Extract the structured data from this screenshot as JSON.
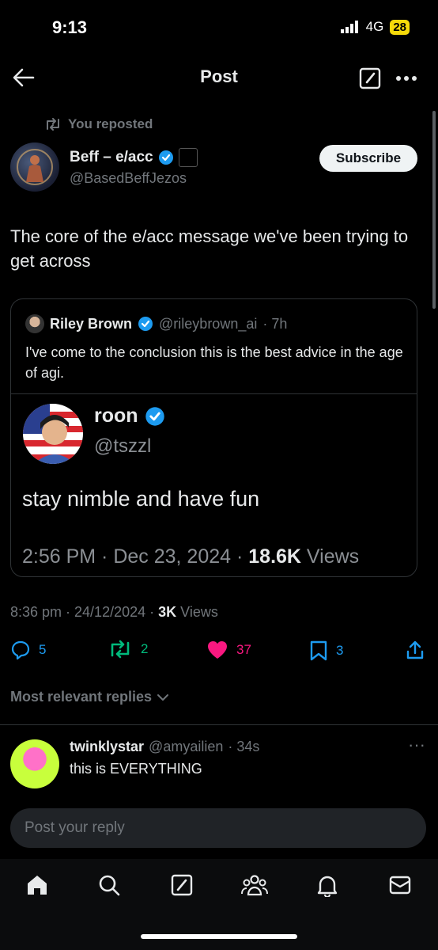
{
  "status": {
    "time": "9:13",
    "network": "4G",
    "battery": "28"
  },
  "nav": {
    "title": "Post"
  },
  "repost": {
    "label": "You reposted"
  },
  "author": {
    "name": "Beff – e/acc",
    "handle": "@BasedBeffJezos",
    "subscribe_label": "Subscribe"
  },
  "post": {
    "text": "The core of the e/acc message we've been trying to get across",
    "timestamp": "8:36 pm · 24/12/2024 · ",
    "views_count": "3K",
    "views_label": " Views"
  },
  "quote": {
    "name": "Riley Brown",
    "handle": "@rileybrown_ai",
    "age": "· 7h",
    "text": "I've come to the conclusion this is the best advice in the age of agi.",
    "inner": {
      "name": "roon",
      "handle": "@tszzl",
      "text": "stay nimble and have fun",
      "meta": "2:56 PM · Dec 23, 2024 · ",
      "views_count": "18.6K",
      "views_label": " Views"
    }
  },
  "actions": {
    "replies": "5",
    "reposts": "2",
    "likes": "37",
    "bookmarks": "3"
  },
  "replies_filter": {
    "label": "Most relevant replies"
  },
  "reply": {
    "name": "twinklystar",
    "handle": "@amyailien",
    "age": "· 34s",
    "text": "this is EVERYTHING",
    "more": "···"
  },
  "composer": {
    "placeholder": "Post your reply"
  },
  "colors": {
    "accent": "#1d9bf0",
    "repost": "#00ba7c",
    "like": "#f91880",
    "battery": "#f5d90a"
  },
  "icons": [
    "back-arrow-icon",
    "compose-icon",
    "more-icon",
    "repost-icon",
    "verified-icon",
    "reply-icon",
    "like-icon",
    "bookmark-icon",
    "share-icon",
    "chevron-down-icon",
    "home-icon",
    "search-icon",
    "grok-icon",
    "communities-icon",
    "notifications-icon",
    "messages-icon"
  ]
}
